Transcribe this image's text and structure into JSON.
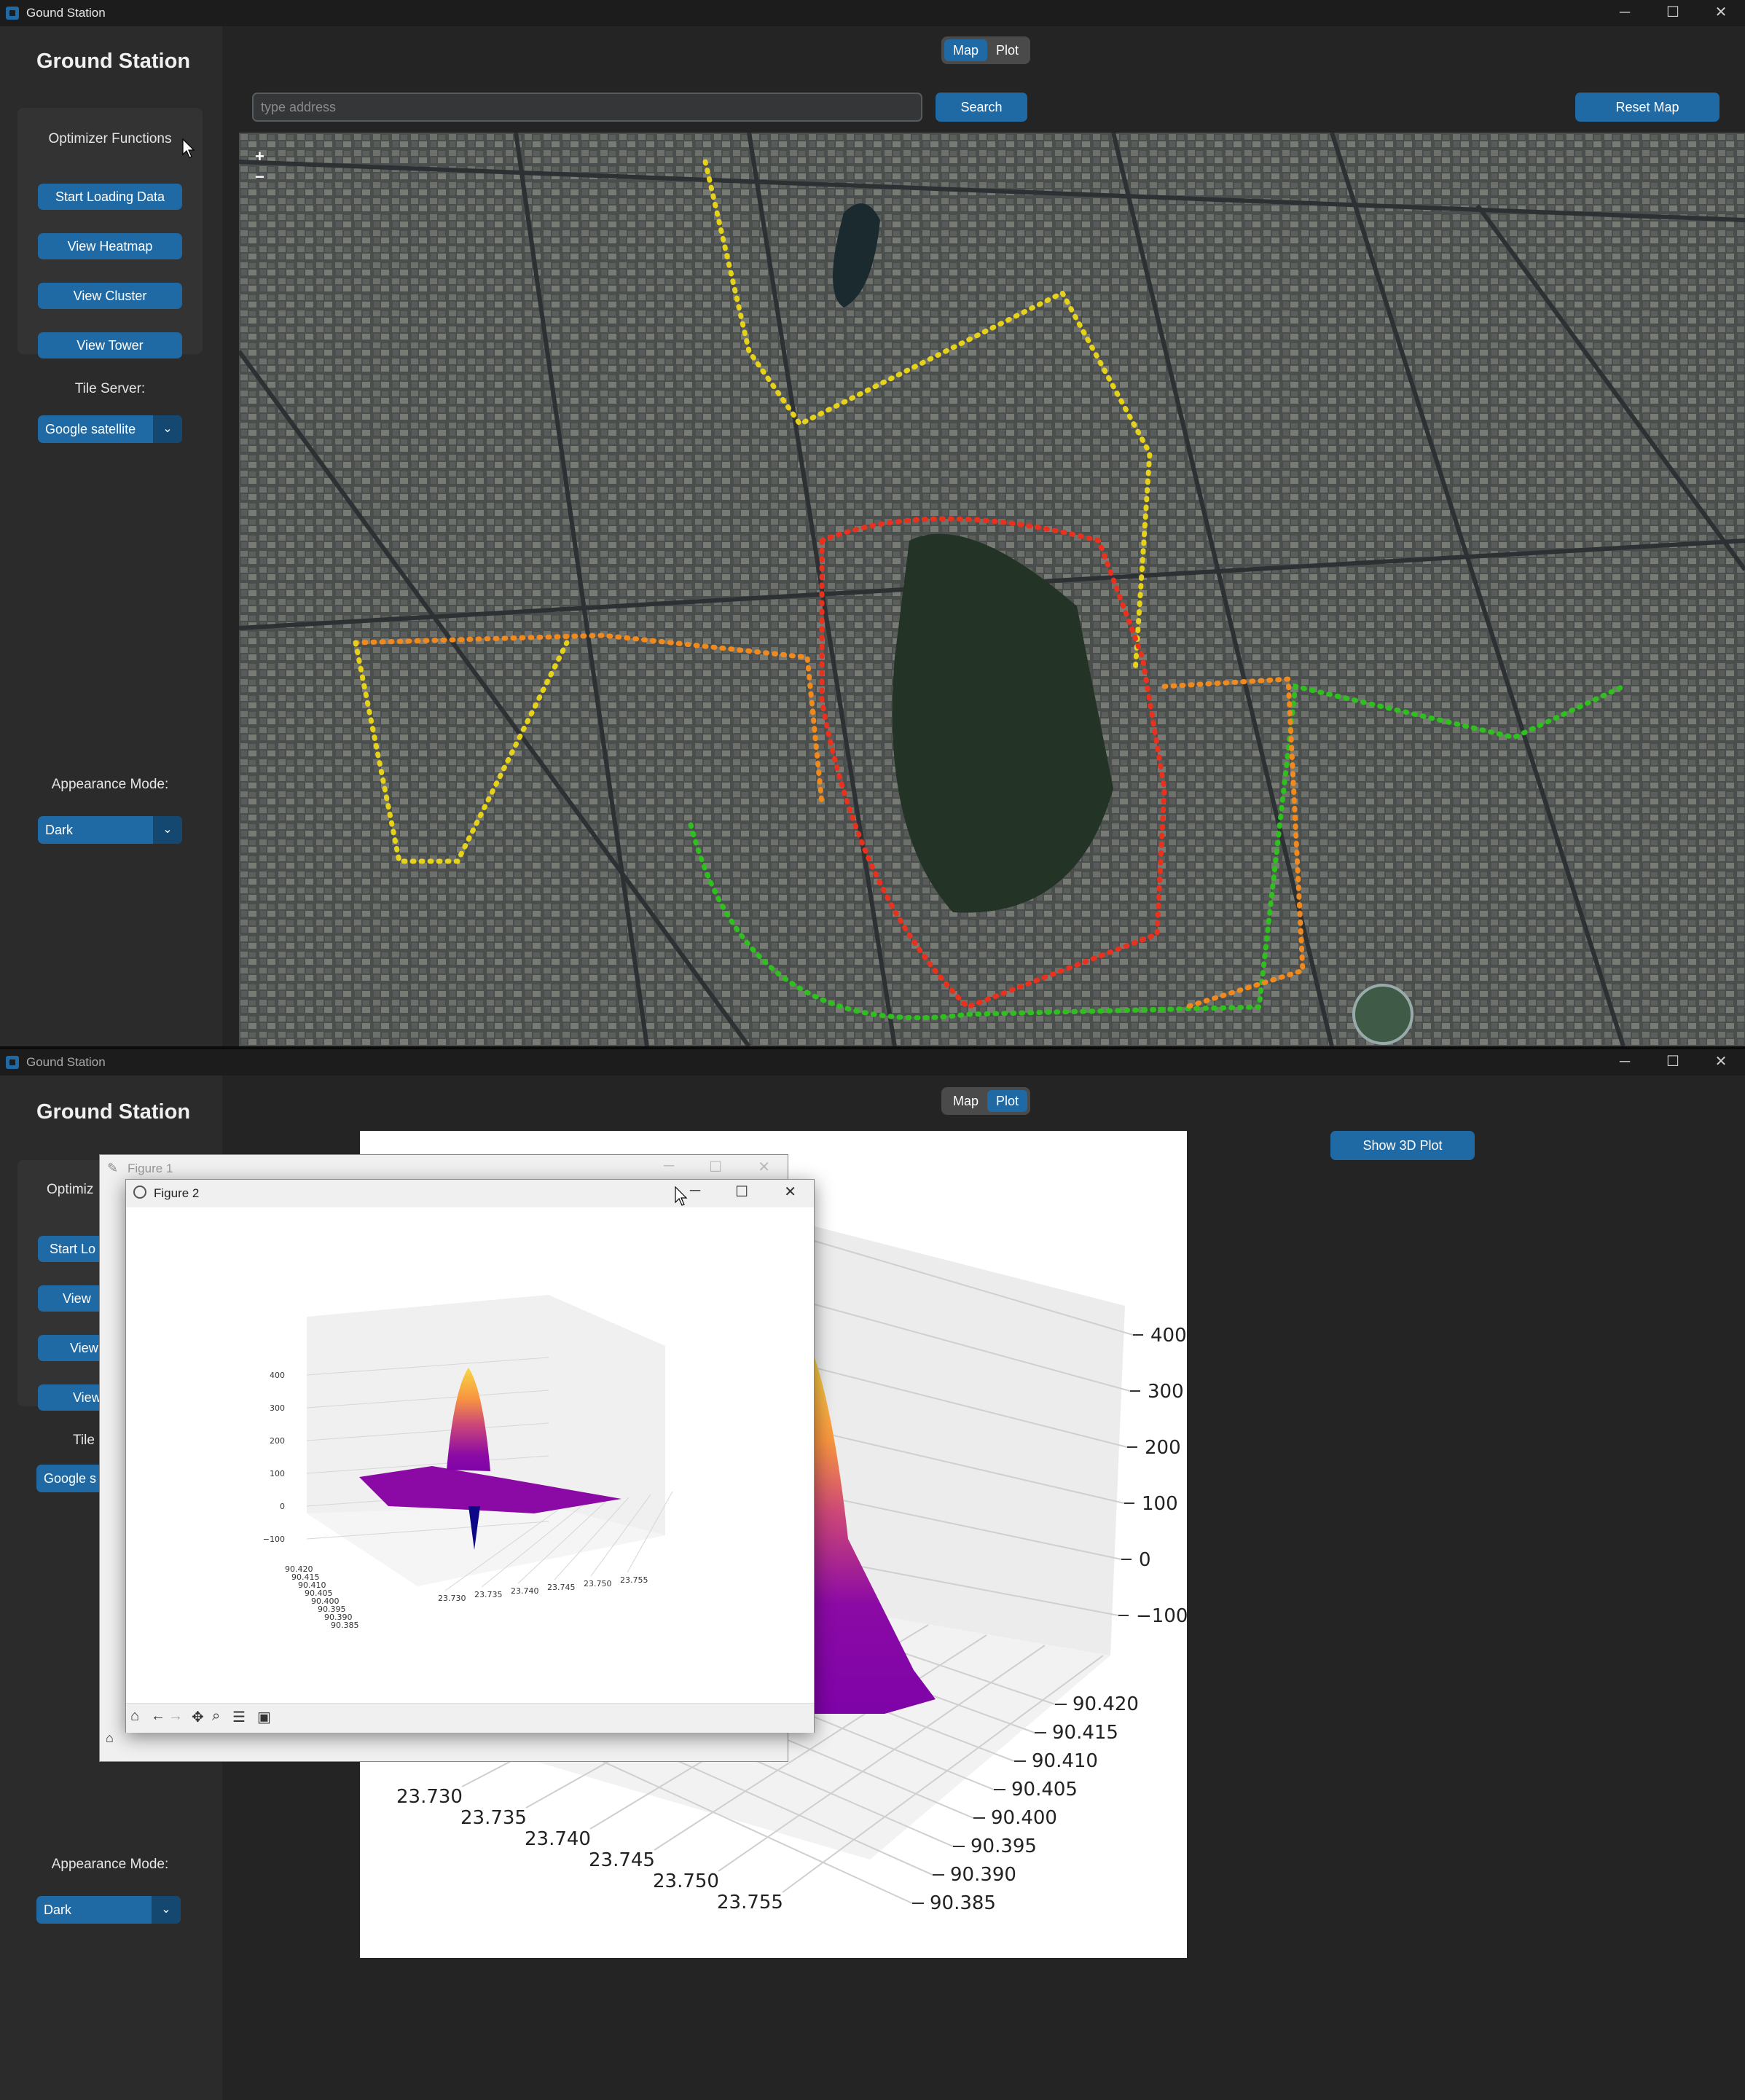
{
  "window": {
    "title": "Gound Station",
    "controls": [
      "─",
      "☐",
      "✕"
    ]
  },
  "app": {
    "title": "Ground Station",
    "optimizer_label": "Optimizer Functions",
    "buttons": {
      "start_loading": "Start Loading Data",
      "view_heatmap": "View Heatmap",
      "view_cluster": "View Cluster",
      "view_tower": "View Tower"
    },
    "tile_server_label": "Tile Server:",
    "tile_server_value": "Google satellite",
    "appearance_label": "Appearance Mode:",
    "appearance_value": "Dark",
    "partial": {
      "optimizer_label": "Optimiz",
      "start_loading": "Start Lo",
      "view1": "View",
      "view2": "View",
      "view3": "View",
      "tile_label": "Tile",
      "tile_value": "Google s"
    }
  },
  "tabs": {
    "map": "Map",
    "plot": "Plot"
  },
  "map_page": {
    "search_placeholder": "type address",
    "search_button": "Search",
    "reset_button": "Reset Map",
    "zoom_in": "+",
    "zoom_out": "−"
  },
  "plot_page": {
    "show3d_button": "Show 3D Plot"
  },
  "figure1": {
    "title": "Figure 1"
  },
  "figure2": {
    "title": "Figure 2",
    "toolbar_icons": [
      "home-icon",
      "back-icon",
      "forward-icon",
      "pan-icon",
      "zoom-icon",
      "configure-icon",
      "save-icon"
    ]
  },
  "colors": {
    "accent": "#1f6aa5",
    "bg": "#242424",
    "sidebar": "#2b2b2b",
    "route_red": "#e8321e",
    "route_orange": "#f08a1e",
    "route_yellow": "#e6d21a",
    "route_green": "#2fc01f"
  },
  "chart_data": [
    {
      "type": "surface3d",
      "title": "",
      "x_ticks": [
        "23.730",
        "23.735",
        "23.740",
        "23.745",
        "23.750",
        "23.755"
      ],
      "y_ticks": [
        "90.385",
        "90.390",
        "90.395",
        "90.400",
        "90.405",
        "90.410",
        "90.415",
        "90.420"
      ],
      "z_ticks": [
        "−100",
        "0",
        "100",
        "200",
        "300",
        "400"
      ],
      "zlim": [
        -120,
        430
      ],
      "colormap": "plasma",
      "peak_z": 410,
      "trough_z": -110
    },
    {
      "type": "surface3d",
      "title": "",
      "x_ticks": [
        "23.730",
        "23.735",
        "23.740",
        "23.745",
        "23.750",
        "23.755"
      ],
      "y_ticks": [
        "90.385",
        "90.390",
        "90.395",
        "90.400",
        "90.405",
        "90.410",
        "90.415",
        "90.420"
      ],
      "z_ticks": [
        "400",
        "300",
        "200",
        "100",
        "0",
        "−100"
      ],
      "zlim": [
        -100,
        400
      ],
      "colormap": "plasma"
    }
  ]
}
